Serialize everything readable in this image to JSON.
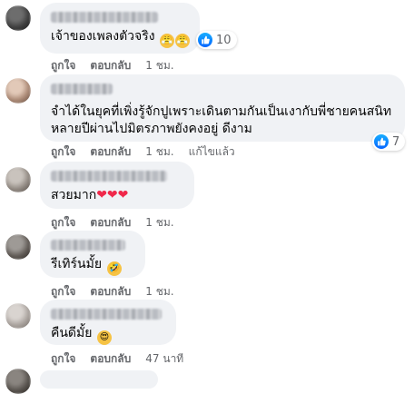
{
  "comments": [
    {
      "text": "เจ้าของเพลงตัวจริง",
      "emojis": [
        "angry-face-emoji",
        "angry-face-emoji"
      ],
      "reaction_count": "10",
      "like_label": "ถูกใจ",
      "reply_label": "ตอบกลับ",
      "time": "1 ชม.",
      "edited": ""
    },
    {
      "text": "จำได้ในยุคที่เพิ่งรู้จักปูเพราะเดินตามกันเป็นเงากับพี่ชายคนสนิท หลายปีผ่านไปมิตรภาพยังคงอยู่ ดีงาม",
      "emojis": [],
      "reaction_count": "7",
      "like_label": "ถูกใจ",
      "reply_label": "ตอบกลับ",
      "time": "1 ชม.",
      "edited": "แก้ไขแล้ว"
    },
    {
      "text": "สวยมาก",
      "emojis": [
        "❤",
        "❤",
        "❤"
      ],
      "reaction_count": "",
      "like_label": "ถูกใจ",
      "reply_label": "ตอบกลับ",
      "time": "1 ชม.",
      "edited": ""
    },
    {
      "text": "รีเทิร์นมั้ย",
      "emojis": [
        "rolling-laughing-emoji"
      ],
      "reaction_count": "",
      "like_label": "ถูกใจ",
      "reply_label": "ตอบกลับ",
      "time": "1 ชม.",
      "edited": ""
    },
    {
      "text": "คืนดีมั้ย",
      "emojis": [
        "heart-eyes-emoji"
      ],
      "reaction_count": "",
      "like_label": "ถูกใจ",
      "reply_label": "ตอบกลับ",
      "time": "47 นาที",
      "edited": ""
    }
  ],
  "colors": {
    "bubble": "#f0f2f5",
    "meta_text": "#65676b",
    "like_blue": "#0866ff",
    "heart_red": "#f0284a"
  }
}
